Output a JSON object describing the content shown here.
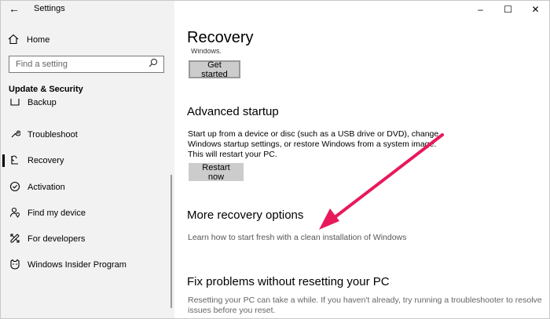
{
  "titlebar": {
    "title": "Settings",
    "back_icon": "←",
    "minimize": "–",
    "maximize": "☐",
    "close": "✕"
  },
  "sidebar": {
    "home_label": "Home",
    "search_placeholder": "Find a setting",
    "section_header": "Update & Security",
    "items": [
      {
        "label": "Backup",
        "icon": "backup-icon"
      },
      {
        "label": "Troubleshoot",
        "icon": "wrench-icon"
      },
      {
        "label": "Recovery",
        "icon": "recovery-icon",
        "selected": true
      },
      {
        "label": "Activation",
        "icon": "check-circle-icon"
      },
      {
        "label": "Find my device",
        "icon": "person-location-icon"
      },
      {
        "label": "For developers",
        "icon": "developer-tools-icon"
      },
      {
        "label": "Windows Insider Program",
        "icon": "insider-cat-icon"
      }
    ]
  },
  "main": {
    "title": "Recovery",
    "cut_text": "Windows.",
    "get_started_label": "Get started",
    "advanced_startup": {
      "heading": "Advanced startup",
      "description": "Start up from a device or disc (such as a USB drive or DVD), change Windows startup settings, or restore Windows from a system image. This will restart your PC.",
      "button_label": "Restart now"
    },
    "more_options": {
      "heading": "More recovery options",
      "link": "Learn how to start fresh with a clean installation of Windows"
    },
    "fix_problems": {
      "heading": "Fix problems without resetting your PC",
      "description": "Resetting your PC can take a while. If you haven't already, try running a troubleshooter to resolve issues before you reset."
    }
  },
  "colors": {
    "sidebar_bg": "#f2f2f2",
    "button_bg": "#cccccc",
    "annotation_arrow": "#e8195a"
  }
}
